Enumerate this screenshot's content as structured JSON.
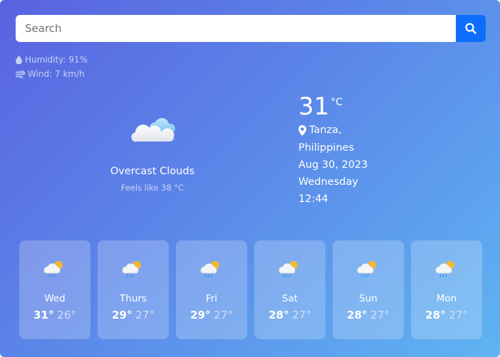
{
  "search": {
    "placeholder": "Search"
  },
  "meta": {
    "humidity": "Humidity: 91%",
    "wind": "Wind: 7 km/h"
  },
  "current": {
    "condition": "Overcast Clouds",
    "feels_like": "Feels like 38 °C",
    "temperature": "31",
    "unit": "°C",
    "location_line1": "Tanza,",
    "location_line2": "Philippines",
    "date": "Aug 30, 2023",
    "day": "Wednesday",
    "time": "12:44",
    "icon": "cloud-icon"
  },
  "forecast": [
    {
      "day": "Wed",
      "high": "31°",
      "low": "26°",
      "icon": "rain-sun-icon"
    },
    {
      "day": "Thurs",
      "high": "29°",
      "low": "27°",
      "icon": "rain-sun-icon"
    },
    {
      "day": "Fri",
      "high": "29°",
      "low": "27°",
      "icon": "rain-sun-icon"
    },
    {
      "day": "Sat",
      "high": "28°",
      "low": "27°",
      "icon": "rain-sun-icon"
    },
    {
      "day": "Sun",
      "high": "28°",
      "low": "27°",
      "icon": "rain-sun-icon"
    },
    {
      "day": "Mon",
      "high": "28°",
      "low": "27°",
      "icon": "rain-sun-icon"
    }
  ],
  "colors": {
    "accent": "#0d6efd",
    "gradient_start": "#5a63e0",
    "gradient_end": "#5fb4f2"
  }
}
